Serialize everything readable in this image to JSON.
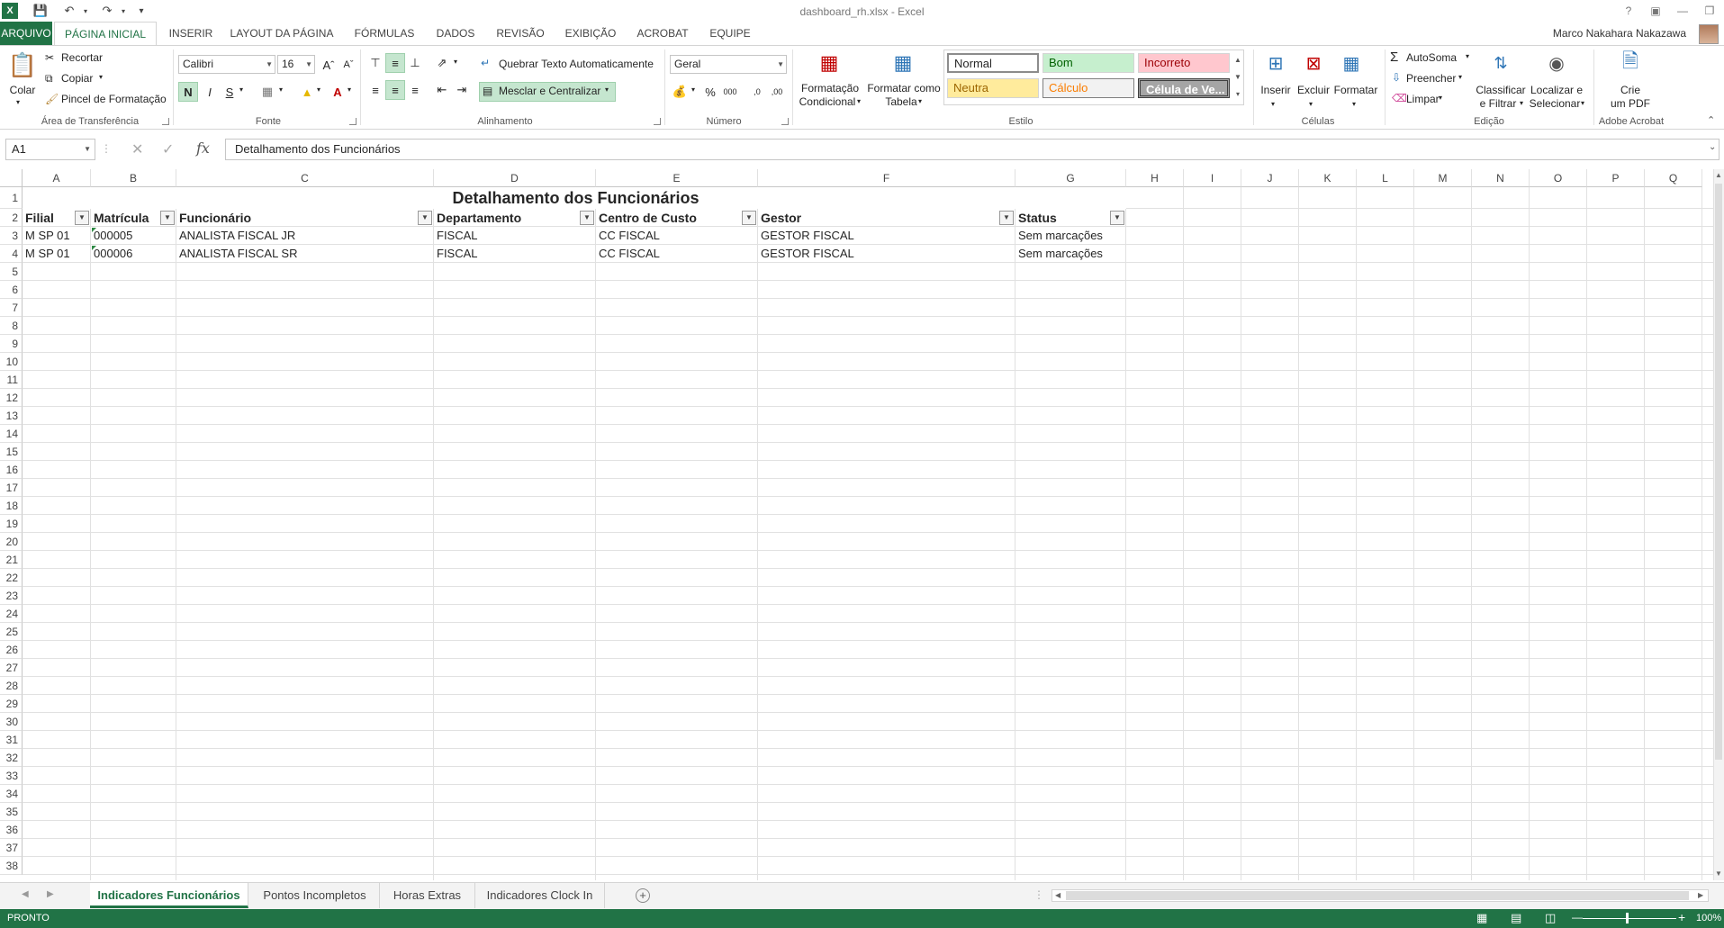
{
  "window": {
    "title": "dashboard_rh.xlsx - Excel",
    "user": "Marco Nakahara Nakazawa"
  },
  "tabs": [
    {
      "label": "ARQUIVO"
    },
    {
      "label": "PÁGINA INICIAL"
    },
    {
      "label": "INSERIR"
    },
    {
      "label": "LAYOUT DA PÁGINA"
    },
    {
      "label": "FÓRMULAS"
    },
    {
      "label": "DADOS"
    },
    {
      "label": "REVISÃO"
    },
    {
      "label": "EXIBIÇÃO"
    },
    {
      "label": "ACROBAT"
    },
    {
      "label": "EQUIPE"
    }
  ],
  "ribbon": {
    "clipboard": {
      "paste": "Colar",
      "cut": "Recortar",
      "copy": "Copiar",
      "painter": "Pincel de Formatação",
      "label": "Área de Transferência"
    },
    "font": {
      "name": "Calibri",
      "size": "16",
      "bold": "N",
      "italic": "I",
      "underline": "S",
      "label": "Fonte"
    },
    "alignment": {
      "wrap": "Quebrar Texto Automaticamente",
      "merge": "Mesclar e Centralizar",
      "label": "Alinhamento"
    },
    "number": {
      "format": "Geral",
      "label": "Número"
    },
    "styles": {
      "cond_line1": "Formatação",
      "cond_line2": "Condicional",
      "table_line1": "Formatar como",
      "table_line2": "Tabela",
      "normal": "Normal",
      "good": "Bom",
      "bad": "Incorreto",
      "neutral": "Neutra",
      "calc": "Cálculo",
      "check": "Célula de Ve...",
      "label": "Estilo"
    },
    "cells": {
      "insert": "Inserir",
      "delete": "Excluir",
      "format": "Formatar",
      "label": "Células"
    },
    "editing": {
      "autosum": "AutoSoma",
      "fill": "Preencher",
      "clear": "Limpar",
      "sort_line1": "Classificar",
      "sort_line2": "e Filtrar",
      "find_line1": "Localizar e",
      "find_line2": "Selecionar",
      "label": "Edição"
    },
    "acrobat": {
      "pdf_line1": "Crie",
      "pdf_line2": "um PDF",
      "label": "Adobe Acrobat"
    }
  },
  "formula": {
    "namebox": "A1",
    "fx": "fx",
    "content": "Detalhamento dos Funcionários"
  },
  "columns": [
    "A",
    "B",
    "C",
    "D",
    "E",
    "F",
    "G",
    "H",
    "I",
    "J",
    "K",
    "L",
    "M",
    "N",
    "O",
    "P",
    "Q"
  ],
  "rows": [
    "1",
    "2",
    "3",
    "4",
    "5",
    "6",
    "7",
    "8",
    "9",
    "10",
    "11",
    "12",
    "13",
    "14",
    "15",
    "16",
    "17",
    "18",
    "19",
    "20",
    "21",
    "22",
    "23",
    "24",
    "25",
    "26",
    "27",
    "28",
    "29",
    "30",
    "31",
    "32",
    "33",
    "34",
    "35",
    "36",
    "37",
    "38"
  ],
  "sheet": {
    "title": "Detalhamento dos Funcionários",
    "headers": [
      "Filial",
      "Matrícula",
      "Funcionário",
      "Departamento",
      "Centro de Custo",
      "Gestor",
      "Status"
    ],
    "data": [
      [
        "M SP 01",
        "000005",
        "ANALISTA FISCAL JR",
        "FISCAL",
        "CC FISCAL",
        "GESTOR FISCAL",
        "Sem marcações"
      ],
      [
        "M SP 01",
        "000006",
        "ANALISTA FISCAL SR",
        "FISCAL",
        "CC FISCAL",
        "GESTOR FISCAL",
        "Sem marcações"
      ]
    ]
  },
  "sheet_tabs": [
    {
      "label": "Indicadores Funcionários"
    },
    {
      "label": "Pontos Incompletos"
    },
    {
      "label": "Horas Extras"
    },
    {
      "label": "Indicadores Clock In"
    }
  ],
  "status": {
    "ready": "PRONTO",
    "zoom": "100%"
  },
  "colors": {
    "accent": "#217346",
    "good_bg": "#c6efce",
    "bad_bg": "#ffc7ce",
    "neutral_bg": "#ffeb9c",
    "calc_bg": "#f2f2f2",
    "check_bg": "#a5a5a5"
  }
}
